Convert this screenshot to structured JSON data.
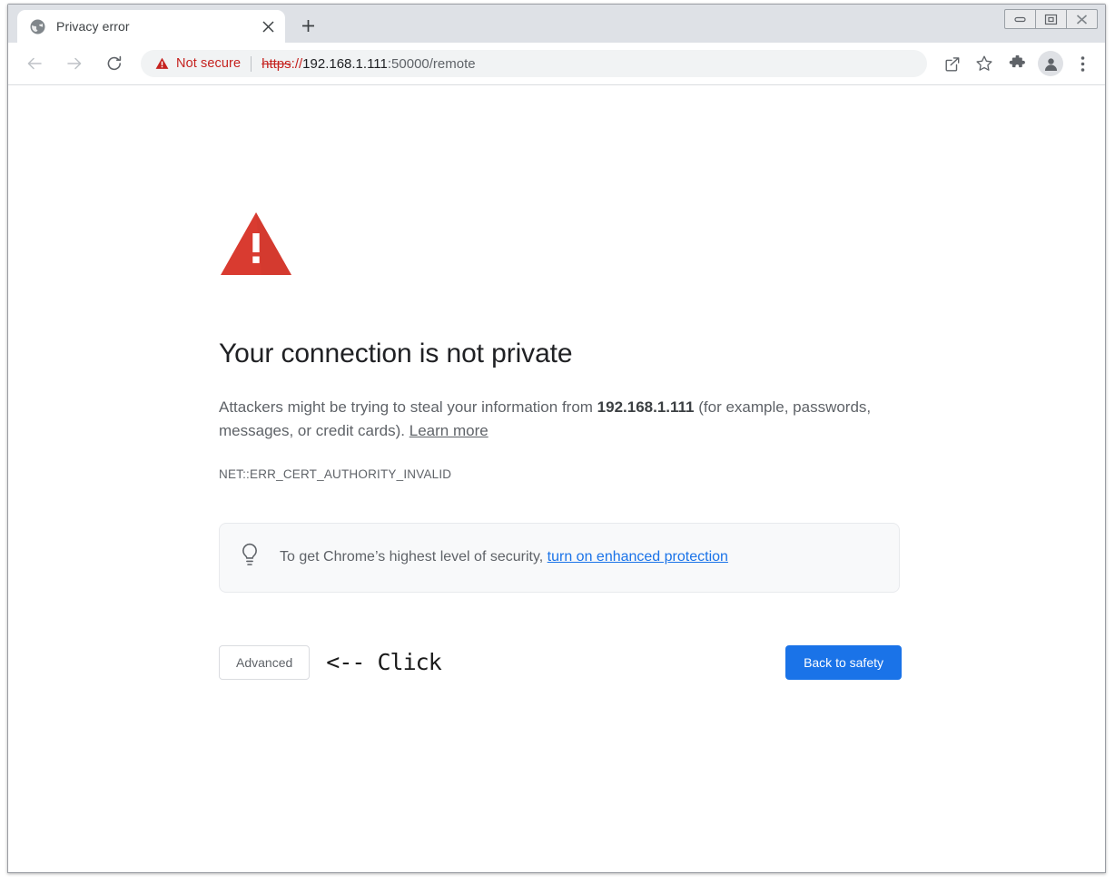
{
  "window": {
    "controls": [
      {
        "name": "minimize-button",
        "label": "Minimize"
      },
      {
        "name": "restore-button",
        "label": "Restore"
      },
      {
        "name": "close-button",
        "label": "Close"
      }
    ]
  },
  "tabstrip": {
    "tab": {
      "title": "Privacy error",
      "favicon": "globe-icon",
      "close_label": "×"
    },
    "new_tab_label": "+"
  },
  "toolbar": {
    "back_icon": "arrow-left-icon",
    "forward_icon": "arrow-right-icon",
    "reload_icon": "reload-icon",
    "security_label": "Not secure",
    "security_icon": "warning-triangle-icon",
    "url": {
      "scheme": "https",
      "separator": "://",
      "host": "192.168.1.111",
      "rest": ":50000/remote",
      "full": "https://192.168.1.111:50000/remote"
    },
    "icons": [
      {
        "name": "share-icon",
        "label": "Share this page"
      },
      {
        "name": "bookmark-star-icon",
        "label": "Bookmark this tab"
      },
      {
        "name": "extensions-puzzle-icon",
        "label": "Extensions"
      },
      {
        "name": "profile-avatar-icon",
        "label": "Profile"
      },
      {
        "name": "more-menu-icon",
        "label": "Customize and control Google Chrome"
      }
    ]
  },
  "page": {
    "warning_icon": "red-warning-triangle-icon",
    "heading": "Your connection is not private",
    "body_prefix": "Attackers might be trying to steal your information from ",
    "body_host": "192.168.1.111",
    "body_suffix": " (for example, passwords, messages, or credit cards). ",
    "learn_more": "Learn more",
    "error_code": "NET::ERR_CERT_AUTHORITY_INVALID",
    "callout": {
      "icon": "lightbulb-icon",
      "text": "To get Chrome’s highest level of security, ",
      "link": "turn on enhanced protection"
    },
    "advanced_button": "Advanced",
    "annotation": "<-- Click",
    "back_to_safety_button": "Back to safety"
  },
  "colors": {
    "danger_red": "#D93025",
    "omnibox_red": "#C5221F",
    "accent_blue": "#1A73E8",
    "text_primary": "#202124",
    "text_secondary": "#5F6368",
    "callout_bg": "#F8F9FA",
    "chrome_frame": "#DEE1E6"
  }
}
